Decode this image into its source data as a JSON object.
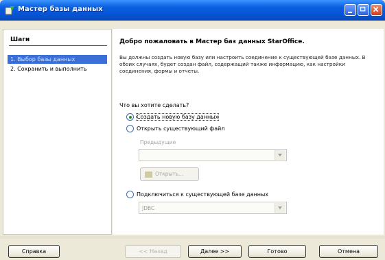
{
  "window": {
    "title": "Мастер базы данных"
  },
  "steps": {
    "title": "Шаги",
    "items": [
      {
        "label": "1. Выбор базы данных"
      },
      {
        "label": "2. Сохранить и выполнить"
      }
    ]
  },
  "main": {
    "heading": "Добро пожаловать в Мастер баз данных StarOffice.",
    "description": "Вы должны создать новую базу или настроить соединение к существующей базе данных. В обоих случаях, будет создан файл, содержащий также информацию, как настройки соединения, формы и отчеты.",
    "question": "Что вы хотите сделать?",
    "options": [
      {
        "label": "Создать новую базу данных",
        "checked": true
      },
      {
        "label": "Открыть существующий файл",
        "checked": false
      },
      {
        "label": "Подключиться к существующей базе данных",
        "checked": false
      }
    ],
    "recent_label": "Предыдущие",
    "recent_value": "",
    "open_button": "Открыть...",
    "connection_value": "JDBC"
  },
  "buttons": {
    "help": "Справка",
    "back": "<< Назад",
    "next": "Далее >>",
    "done": "Готово",
    "cancel": "Отмена"
  },
  "colors": {
    "titlebar": "#0654d6",
    "selected_step": "#3a6fd8",
    "dialog_bg": "#ECE9D8"
  }
}
